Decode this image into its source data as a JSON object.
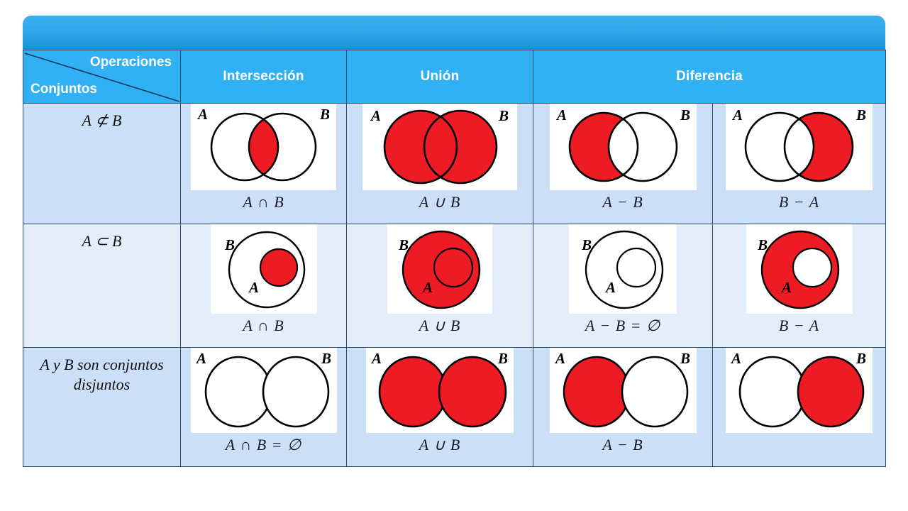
{
  "colors": {
    "banner_top": "#38b0ef",
    "banner_bottom": "#1e8fd8",
    "header_bg": "#32b0f4",
    "row_shade_dark": "#cbdff6",
    "row_shade_light": "#e4eefb",
    "fill_red": "#ED1C24",
    "stroke": "#000000",
    "border": "#2b4b6b"
  },
  "header": {
    "corner_top_label": "Operaciones",
    "corner_bottom_label": "Conjuntos",
    "columns": [
      {
        "label": "Intersección",
        "span": 1
      },
      {
        "label": "Unión",
        "span": 1
      },
      {
        "label": "Diferencia",
        "span": 2
      }
    ]
  },
  "rows": [
    {
      "label": "A ⊄ B",
      "kind": "overlapping",
      "cells": [
        {
          "caption": "A ∩ B",
          "shaded": "intersection",
          "label_a": "A",
          "label_b": "B"
        },
        {
          "caption": "A ∪ B",
          "shaded": "union",
          "label_a": "A",
          "label_b": "B"
        },
        {
          "caption": "A − B",
          "shaded": "a-minus-b",
          "label_a": "A",
          "label_b": "B"
        },
        {
          "caption": "B − A",
          "shaded": "b-minus-a",
          "label_a": "A",
          "label_b": "B"
        }
      ]
    },
    {
      "label": "A ⊂ B",
      "kind": "nested",
      "cells": [
        {
          "caption": "A ∩ B",
          "shaded": "inner-only",
          "label_a": "A",
          "label_b": "B"
        },
        {
          "caption": "A ∪ B",
          "shaded": "outer-all",
          "label_a": "A",
          "label_b": "B"
        },
        {
          "caption": "A − B = ∅",
          "shaded": "none",
          "label_a": "A",
          "label_b": "B"
        },
        {
          "caption": "B − A",
          "shaded": "ring",
          "label_a": "A",
          "label_b": "B"
        }
      ]
    },
    {
      "label": "A y B son conjuntos disjuntos",
      "kind": "disjoint",
      "cells": [
        {
          "caption": "A ∩ B = ∅",
          "shaded": "none",
          "label_a": "A",
          "label_b": "B"
        },
        {
          "caption": "A ∪ B",
          "shaded": "both",
          "label_a": "A",
          "label_b": "B"
        },
        {
          "caption": "A − B",
          "shaded": "left-only",
          "label_a": "A",
          "label_b": "B"
        },
        {
          "caption": "",
          "shaded": "right-only",
          "label_a": "A",
          "label_b": "B"
        }
      ]
    }
  ]
}
